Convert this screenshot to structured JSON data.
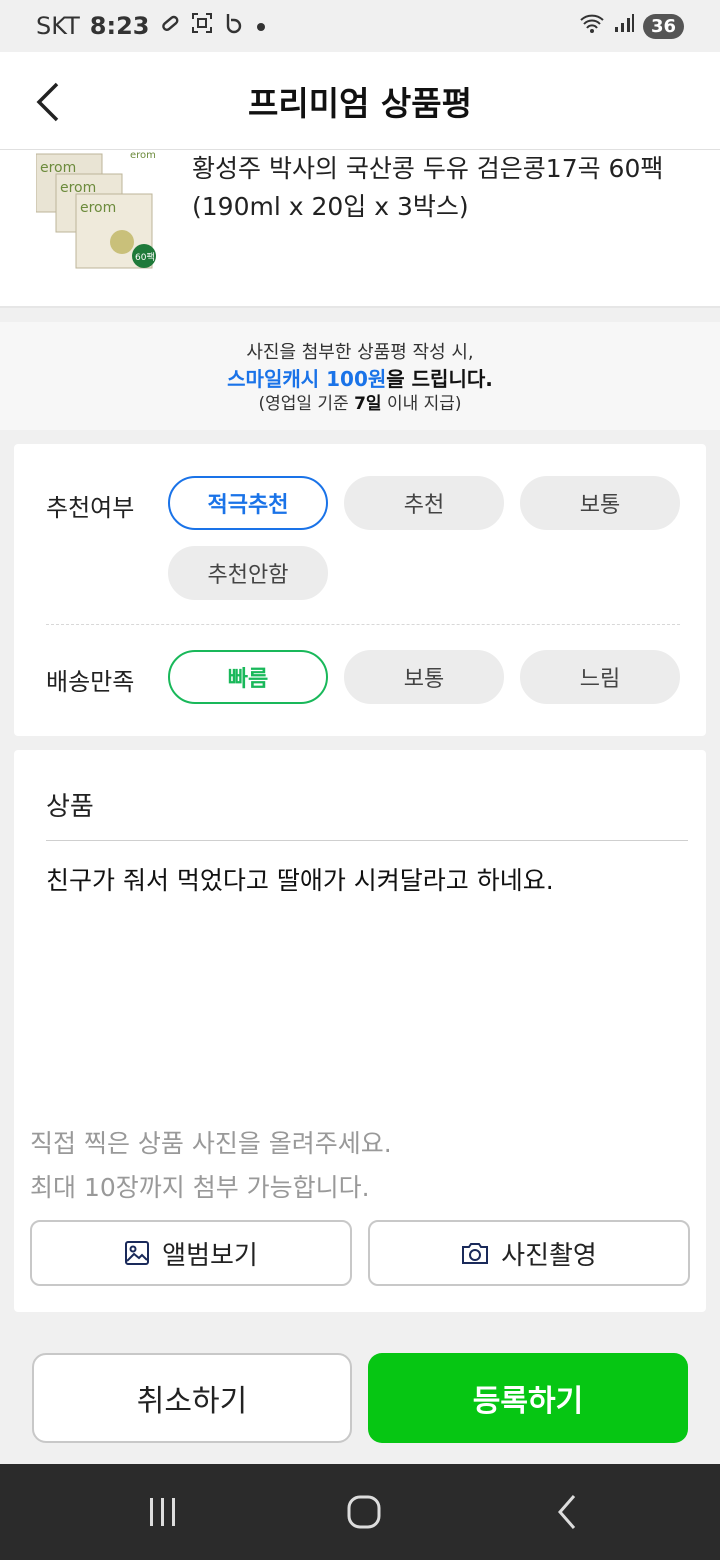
{
  "status_bar": {
    "carrier": "SKT",
    "time": "8:23",
    "icons": [
      "link-icon",
      "screenshot-icon",
      "b-app-icon",
      "dot-icon"
    ],
    "right_icons": [
      "wifi-icon",
      "signal-icon"
    ],
    "battery": "36"
  },
  "header": {
    "title": "프리미엄 상품평"
  },
  "product": {
    "name": "황성주 박사의 국산콩 두유 검은콩17곡 60팩(190ml x 20입 x 3박스)",
    "brand_label": "erom",
    "badge": "60팩"
  },
  "promo": {
    "line1": "사진을 첨부한 상품평 작성 시,",
    "line2_highlight": "스마일캐시 100원",
    "line2_rest": "을 드립니다.",
    "line3_prefix": "(영업일 기준 ",
    "line3_bold": "7일",
    "line3_suffix": " 이내 지급)"
  },
  "recommend": {
    "label": "추천여부",
    "options": [
      "적극추천",
      "추천",
      "보통",
      "추천안함"
    ],
    "selected": "적극추천"
  },
  "delivery": {
    "label": "배송만족",
    "options": [
      "빠름",
      "보통",
      "느림"
    ],
    "selected": "빠름"
  },
  "review": {
    "label": "상품",
    "text": "친구가 줘서 먹었다고 딸애가 시켜달라고 하네요.",
    "photo_hint_1": "직접 찍은 상품 사진을 올려주세요.",
    "photo_hint_2": "최대 10장까지 첨부 가능합니다.",
    "album_button": "앨범보기",
    "camera_button": "사진촬영"
  },
  "actions": {
    "cancel": "취소하기",
    "submit": "등록하기"
  },
  "colors": {
    "blue_accent": "#1a73e8",
    "green_accent": "#19b85a",
    "submit_green": "#06c613"
  }
}
